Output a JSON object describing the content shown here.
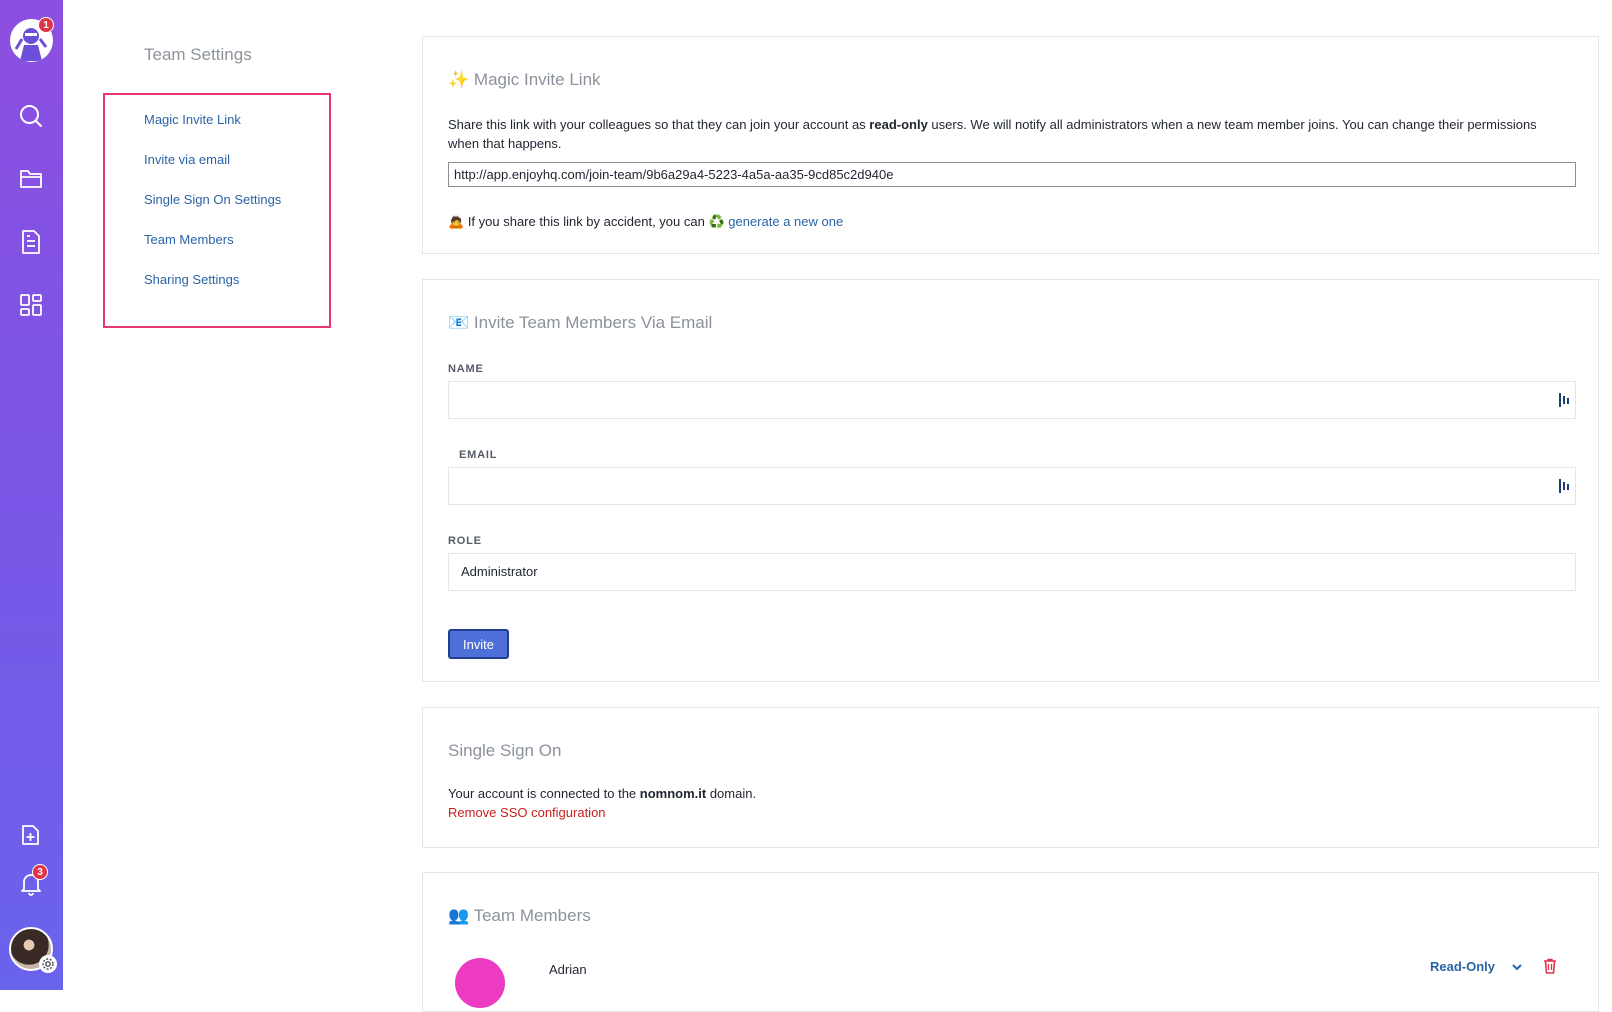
{
  "rail": {
    "logo_badge": "1",
    "notifications_badge": "3",
    "icons": [
      "search-icon",
      "folder-icon",
      "document-icon",
      "grid-icon",
      "add-project-icon",
      "bell-icon",
      "gear-icon"
    ]
  },
  "sidebar": {
    "title": "Team Settings",
    "items": [
      {
        "label": "Magic Invite Link"
      },
      {
        "label": "Invite via email"
      },
      {
        "label": "Single Sign On Settings"
      },
      {
        "label": "Team Members"
      },
      {
        "label": "Sharing Settings"
      }
    ]
  },
  "magic_link": {
    "emoji": "✨",
    "title": "Magic Invite Link",
    "desc_pre": "Share this link with your colleagues so that they can join your account as ",
    "desc_bold": "read-only",
    "desc_post": " users. We will notify all administrators when a new team member joins. You can change their permissions when that happens.",
    "url": "http://app.enjoyhq.com/join-team/9b6a29a4-5223-4a5a-aa35-9cd85c2d940e",
    "accident_emoji": "🙇",
    "accident_text": "If you share this link by accident, you can",
    "recycle_emoji": "♻️",
    "regenerate_label": "generate a new one"
  },
  "invite_email": {
    "emoji": "📧",
    "title": "Invite Team Members Via Email",
    "name_label": "NAME",
    "name_value": "",
    "email_label": "EMAIL",
    "email_value": "",
    "role_label": "ROLE",
    "role_value": "Administrator",
    "invite_label": "Invite"
  },
  "sso": {
    "title": "Single Sign On",
    "desc_pre": "Your account is connected to the ",
    "desc_bold": "nomnom.it",
    "desc_post": " domain.",
    "remove_label": "Remove SSO configuration"
  },
  "team_members": {
    "emoji": "👥",
    "title": "Team Members",
    "members": [
      {
        "name": "Adrian",
        "role": "Read-Only"
      }
    ]
  },
  "colors": {
    "rail_top": "#8d4fe0",
    "rail_bottom": "#6a63ec",
    "link": "#2a64a6",
    "highlight_box": "#e8386f",
    "button": "#4e6fd8",
    "danger": "#c81e1e"
  }
}
